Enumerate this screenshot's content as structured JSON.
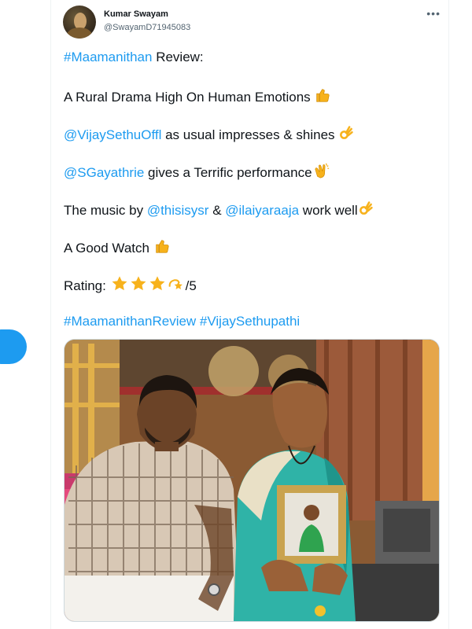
{
  "author": {
    "name": "Kumar Swayam",
    "handle": "@SwayamD71945083"
  },
  "more_label": "•••",
  "tweet": {
    "line1": {
      "tag": "#Maamanithan",
      "rest": " Review:"
    },
    "line2": {
      "text": "A Rural Drama High On Human Emotions "
    },
    "line3": {
      "mention": "@VijaySethuOffl",
      "rest": " as usual impresses & shines "
    },
    "line4": {
      "mention": "@SGayathrie",
      "rest": " gives a Terrific performance"
    },
    "line5": {
      "pre": "The music by ",
      "m1": "@thisisysr",
      "mid": " & ",
      "m2": "@ilaiyaraaja",
      "rest": " work well"
    },
    "line6": {
      "text": "A Good Watch "
    },
    "line7": {
      "pre": "Rating: ",
      "rest": "/5",
      "stars_value": 3.5,
      "stars_max": 4
    },
    "line8": {
      "tags": "#MaamanithanReview #VijaySethupathi"
    }
  },
  "icons": {
    "thumbs_up": "thumbs-up-icon",
    "ok_hand": "ok-hand-icon",
    "clap": "clapping-hands-icon",
    "star": "star-icon",
    "dizzy": "dizzy-star-icon"
  },
  "colors": {
    "link": "#1d9bf0",
    "text": "#0f1419",
    "muted": "#536471",
    "emoji": "#f7b21c"
  }
}
